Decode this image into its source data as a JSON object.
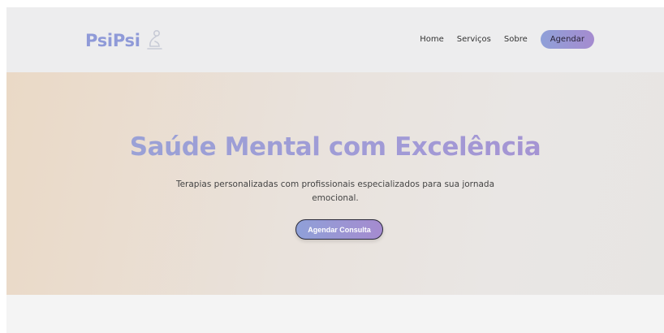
{
  "brand": {
    "name": "PsiPsi",
    "logo_icon": "seated-figure-icon",
    "color": "#8f9ad8"
  },
  "nav": {
    "items": [
      {
        "label": "Home"
      },
      {
        "label": "Serviços"
      },
      {
        "label": "Sobre"
      }
    ],
    "cta_label": "Agendar"
  },
  "hero": {
    "title": "Saúde Mental com Excelência",
    "subtitle": "Terapias personalizadas com profissionais especializados para sua jornada emocional.",
    "cta_label": "Agendar Consulta"
  },
  "colors": {
    "accent_start": "#8fa0d8",
    "accent_end": "#a58bcf",
    "hero_bg_left": "#ead9c6",
    "hero_bg_right": "#e7e5e3",
    "header_bg": "#ededee"
  }
}
